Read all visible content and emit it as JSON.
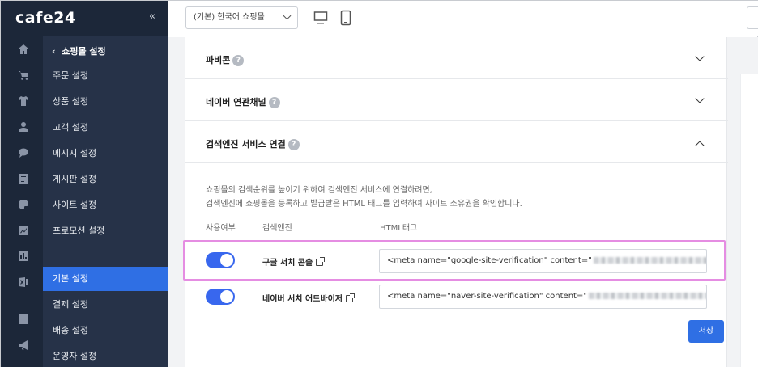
{
  "sidebar": {
    "logo": "cafe24",
    "collapse_icon": "«",
    "submenu_title": "쇼핑몰 설정",
    "items": [
      {
        "label": "주문 설정"
      },
      {
        "label": "상품 설정"
      },
      {
        "label": "고객 설정"
      },
      {
        "label": "메시지 설정"
      },
      {
        "label": "게시판 설정"
      },
      {
        "label": "사이트 설정"
      },
      {
        "label": "프로모션 설정"
      },
      {
        "label": "기본 설정",
        "active": true
      },
      {
        "label": "결제 설정"
      },
      {
        "label": "배송 설정"
      },
      {
        "label": "운영자 설정"
      }
    ],
    "rail_icons": [
      "home-icon",
      "cart-icon",
      "shirt-icon",
      "user-icon",
      "chat-icon",
      "document-icon",
      "palette-icon",
      "chart-icon",
      "stats-icon",
      "excel-icon",
      "store-icon",
      "megaphone-icon"
    ]
  },
  "topbar": {
    "language_select": "(기본) 한국어 쇼핑몰",
    "device_icons": [
      "pc-icon",
      "mobile-icon"
    ]
  },
  "sections": {
    "favicon": {
      "title": "파비콘"
    },
    "naver_channel": {
      "title": "네이버 연관채널"
    },
    "search_engine": {
      "title": "검색엔진 서비스 연결",
      "desc_line1": "쇼핑몰의 검색순위를 높이기 위하여 검색엔진 서비스에 연결하려면,",
      "desc_line2": "검색엔진에 쇼핑몰을 등록하고 발급받은 HTML 태그를 입력하여 사이트 소유권을 확인합니다.",
      "col_use": "사용여부",
      "col_engine": "검색엔진",
      "col_html": "HTML태그",
      "rows": [
        {
          "engine": "구글 서치 콘솔",
          "enabled": true,
          "html_tag": "<meta name=\"google-site-verification\" content=\""
        },
        {
          "engine": "네이버 서치 어드바이저",
          "enabled": true,
          "html_tag": "<meta name=\"naver-site-verification\" content=\""
        }
      ],
      "save_label": "저장"
    }
  },
  "colors": {
    "sidebar_bg": "#1c2739",
    "submenu_bg": "#263248",
    "accent": "#2f6fe4",
    "toggle_on": "#3867ee",
    "highlight": "#e58de2"
  }
}
